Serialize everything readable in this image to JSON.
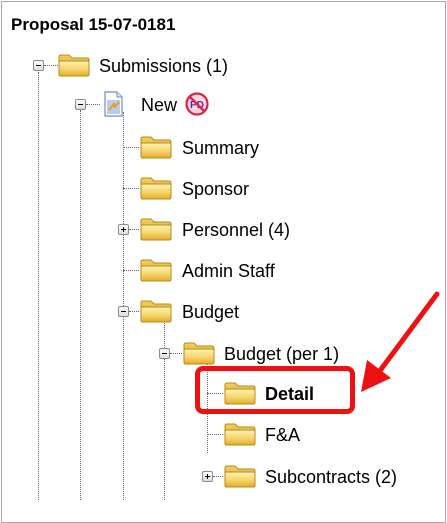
{
  "proposal_title": "Proposal 15-07-0181",
  "tree": {
    "submissions": "Submissions (1)",
    "new": "New",
    "no_pd_badge": "PD",
    "summary": "Summary",
    "sponsor": "Sponsor",
    "personnel": "Personnel (4)",
    "admin_staff": "Admin Staff",
    "budget": "Budget",
    "budget_per": "Budget (per 1)",
    "detail": "Detail",
    "fa": "F&A",
    "subcontracts": "Subcontracts (2)"
  },
  "colors": {
    "callout": "#ee1111",
    "folder_fill": "#f6d46a",
    "folder_edge": "#b88a14"
  },
  "icons": [
    "folder-icon",
    "document-icon",
    "no-pd-icon",
    "expand-toggle-icon",
    "collapse-toggle-icon"
  ]
}
